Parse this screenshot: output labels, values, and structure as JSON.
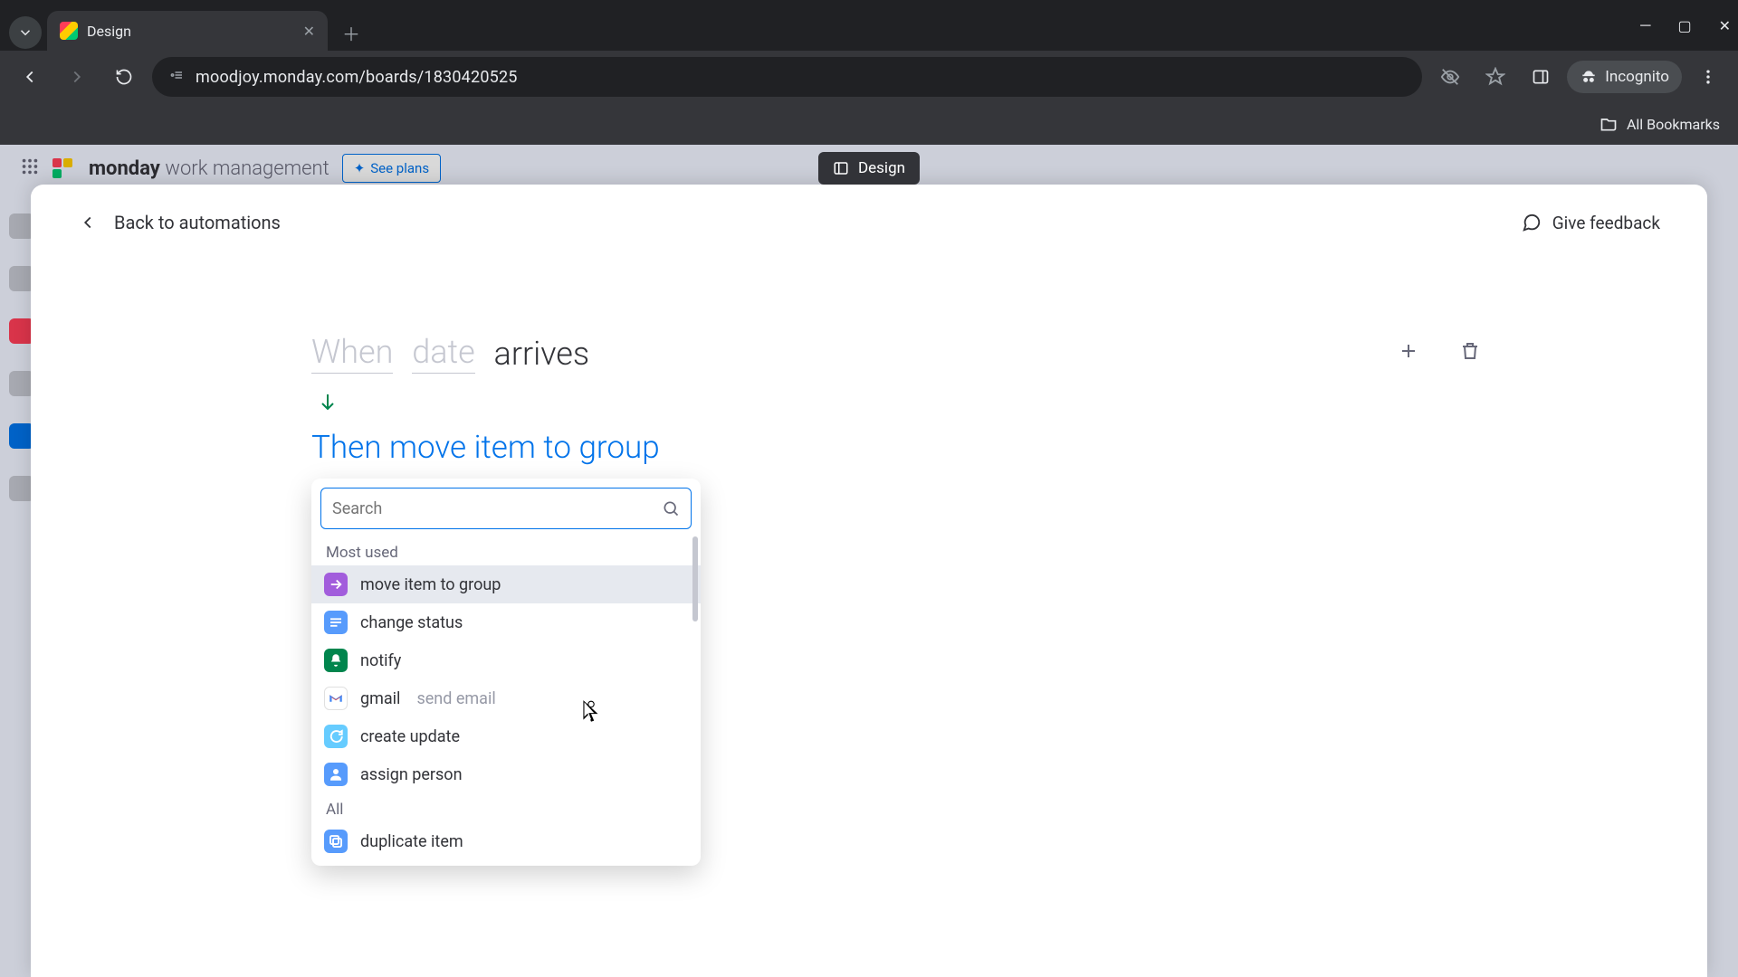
{
  "browser": {
    "tab_title": "Design",
    "url": "moodjoy.monday.com/boards/1830420525",
    "incognito_label": "Incognito",
    "all_bookmarks": "All Bookmarks"
  },
  "app_bg": {
    "brand_bold": "monday",
    "brand_light": "work management",
    "see_plans": "See plans",
    "top_pill": "Design"
  },
  "modal": {
    "back_label": "Back to automations",
    "feedback_label": "Give feedback",
    "trigger": {
      "when": "When",
      "date": "date",
      "arrives": "arrives"
    },
    "then_line": "Then move item to group",
    "search_placeholder": "Search",
    "sections": {
      "most_used": "Most used",
      "all": "All"
    },
    "items": {
      "move": "move item to group",
      "change": "change status",
      "notify": "notify",
      "gmail": "gmail",
      "gmail_sub": "send email",
      "create_update": "create update",
      "assign": "assign person",
      "duplicate": "duplicate item"
    },
    "icon_colors": {
      "move": "#a25ddc",
      "change": "#579bfc",
      "notify": "#00854d",
      "gmail": "#ffffff",
      "create_update": "#66ccff",
      "assign": "#579bfc",
      "duplicate": "#579bfc"
    }
  }
}
